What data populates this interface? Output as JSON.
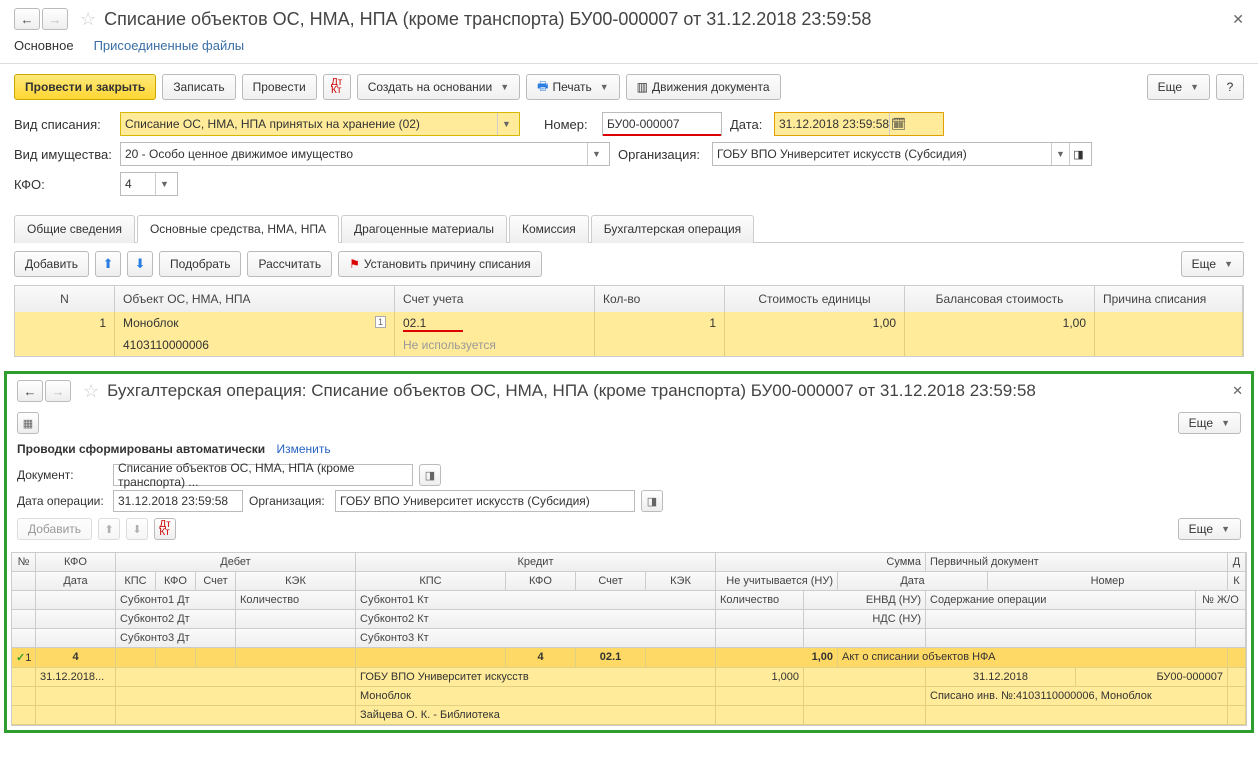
{
  "header": {
    "title": "Списание объектов ОС, НМА, НПА (кроме транспорта) БУ00-000007 от 31.12.2018 23:59:58"
  },
  "subnav": {
    "main": "Основное",
    "files": "Присоединенные файлы"
  },
  "cmd": {
    "post_close": "Провести и закрыть",
    "save": "Записать",
    "post": "Провести",
    "create_based": "Создать на основании",
    "print": "Печать",
    "movements": "Движения документа",
    "more": "Еще"
  },
  "form": {
    "writeoff_type_lbl": "Вид списания:",
    "writeoff_type": "Списание ОС, НМА, НПА принятых на хранение (02)",
    "number_lbl": "Номер:",
    "number": "БУ00-000007",
    "date_lbl": "Дата:",
    "date": "31.12.2018 23:59:58",
    "asset_kind_lbl": "Вид имущества:",
    "asset_kind": "20 - Особо ценное движимое имущество",
    "org_lbl": "Организация:",
    "org": "ГОБУ ВПО Университет искусств (Субсидия)",
    "kfo_lbl": "КФО:",
    "kfo": "4"
  },
  "tabs": {
    "t1": "Общие сведения",
    "t2": "Основные средства, НМА, НПА",
    "t3": "Драгоценные материалы",
    "t4": "Комиссия",
    "t5": "Бухгалтерская операция"
  },
  "tbltb": {
    "add": "Добавить",
    "pick": "Подобрать",
    "calc": "Рассчитать",
    "set_reason": "Установить причину списания",
    "more": "Еще"
  },
  "cols": {
    "n": "N",
    "obj": "Объект ОС, НМА, НПА",
    "acct": "Счет учета",
    "qty": "Кол-во",
    "unit_cost": "Стоимость единицы",
    "bal_cost": "Балансовая стоимость",
    "reason": "Причина списания"
  },
  "row": {
    "n": "1",
    "obj": "Моноблок",
    "obj_code": "4103110000006",
    "acct": "02.1",
    "acct_sub": "Не используется",
    "qty": "1",
    "unit_cost": "1,00",
    "bal_cost": "1,00"
  },
  "panel": {
    "title": "Бухгалтерская операция: Списание объектов ОС, НМА, НПА (кроме транспорта) БУ00-000007 от 31.12.2018 23:59:58",
    "auto": "Проводки сформированы автоматически",
    "change": "Изменить",
    "doc_lbl": "Документ:",
    "doc": "Списание объектов ОС, НМА, НПА (кроме транспорта) ...",
    "opdate_lbl": "Дата операции:",
    "opdate": "31.12.2018 23:59:58",
    "org_lbl": "Организация:",
    "org": "ГОБУ ВПО Университет искусств (Субсидия)",
    "add": "Добавить",
    "more": "Еще"
  },
  "grid_head": {
    "num": "№",
    "kfo": "КФО",
    "debit": "Дебет",
    "credit": "Кредит",
    "amount": "Сумма",
    "prim_doc": "Первичный документ",
    "date": "Дата",
    "kps": "КПС",
    "kfo2": "КФО",
    "acct": "Счет",
    "kek": "КЭК",
    "nu": "Не учитывается (НУ)",
    "date2": "Дата",
    "num2": "Номер",
    "sub1d": "Субконто1 Дт",
    "sub2d": "Субконто2 Дт",
    "sub3d": "Субконто3 Дт",
    "qty_d": "Количество",
    "sub1k": "Субконто1 Кт",
    "sub2k": "Субконто2 Кт",
    "sub3k": "Субконто3 Кт",
    "qty_k": "Количество",
    "envd": "ЕНВД (НУ)",
    "nds": "НДС (НУ)",
    "content": "Содержание операции",
    "jo": "№ Ж/О"
  },
  "grid_row": {
    "n": "1",
    "kfo": "4",
    "kfo_k": "4",
    "acct_k": "02.1",
    "amount": "1,00",
    "prim_doc": "Акт о списании объектов НФА",
    "date": "31.12.2018...",
    "qty_k": "1,000",
    "date2": "31.12.2018",
    "num2": "БУ00-000007",
    "sub1k": "ГОБУ ВПО Университет искусств",
    "sub2k": "Моноблок",
    "sub3k": "Зайцева О. К. - Библиотека",
    "content": "Списано инв. №:4103110000006, Моноблок"
  }
}
